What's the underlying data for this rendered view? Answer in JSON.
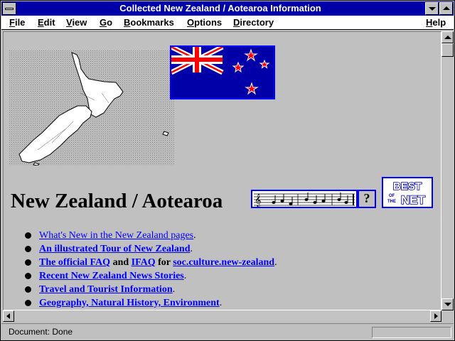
{
  "window": {
    "title": "Collected New Zealand / Aotearoa Information"
  },
  "menu": {
    "items": [
      "File",
      "Edit",
      "View",
      "Go",
      "Bookmarks",
      "Options",
      "Directory"
    ],
    "help": "Help"
  },
  "page": {
    "heading": "New Zealand / Aotearoa",
    "help_button": "?",
    "best_of_net_logo": "BEST OF THE NET",
    "links": [
      {
        "text": "What's New in the New Zealand pages"
      },
      {
        "text": "An illustrated Tour of New Zealand"
      },
      {
        "pre": "",
        "link1": "The official FAQ",
        "mid1": " and ",
        "link2": "IFAQ",
        "mid2": " for ",
        "link3": "soc.culture.new-zealand"
      },
      {
        "text": "Recent New Zealand News Stories"
      },
      {
        "text": "Travel and Tourist Information"
      },
      {
        "text": "Geography, Natural History, Environment"
      }
    ],
    "punct": "."
  },
  "status": {
    "text": "Document: Done"
  },
  "colors": {
    "titlebar": "#0000a8",
    "link": "#0000ff",
    "background": "#c0c0c0",
    "flag_blue": "#0000a8",
    "flag_red": "#ff0000"
  },
  "icons": [
    "system-menu-icon",
    "minimize-icon",
    "maximize-icon",
    "new-zealand-map-image",
    "new-zealand-flag-image",
    "best-of-the-net-logo",
    "anthem-music-icon",
    "help-icon"
  ]
}
